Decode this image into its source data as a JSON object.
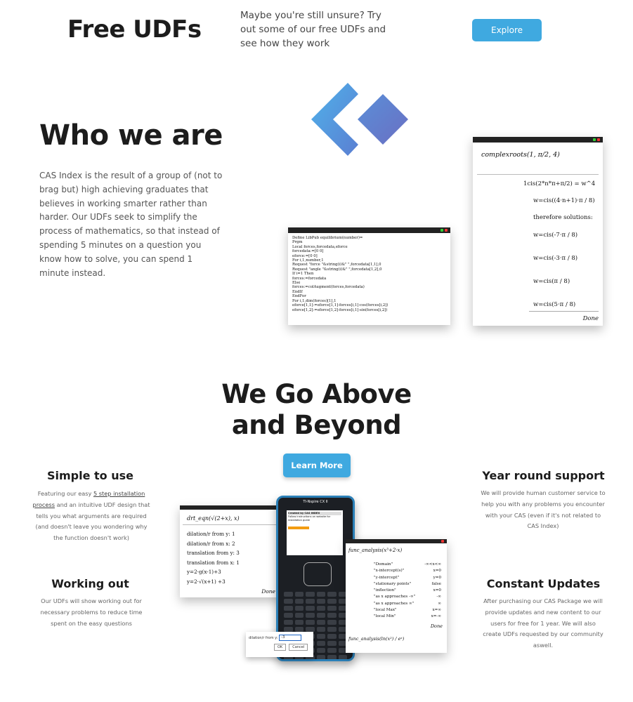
{
  "free_udfs": {
    "title": "Free UDFs",
    "text": "Maybe you're still unsure? Try out some of our free UDFs and see how they work",
    "button": "Explore"
  },
  "who": {
    "title": "Who we are",
    "text": "CAS Index is the result of a group of (not to brag but) high achieving graduates that believes in working smarter rather than harder. Our UDFs seek to simplify the process of mathematics, so that instead of spending 5 minutes on a question you know how to solve, you can spend 1 minute instead."
  },
  "code_card": {
    "lines": [
      "Define LibPub equilibrium(number)=",
      "Prgm",
      "Local forces,forcedata,eforce",
      "forcedata:=[0  0]",
      "eforce:=[0  0]",
      "For i,1,number,1",
      "  Request \"force \"&string(i)&\" \",forcedata[1,1],0",
      "  Request \"angle \"&string(i)&\" \",forcedata[1,2],0",
      "  If i=1 Then",
      "    forces:=forcedata",
      "  Else",
      "    forces:=colAugment(forces,forcedata)",
      "  EndIf",
      "EndFor",
      "For i,1,dim(forces)[1],1",
      "  eforce[1,1]:=eforce[1,1]-forces[i,1]·cos(forces[i,2])",
      "  eforce[1,2]:=eforce[1,2]-forces[i,1]·sin(forces[i,2])"
    ]
  },
  "complex_card": {
    "head": "complexroots(1, π/2, 4)",
    "first": "1cis(2*n*π+π/2) = w^4",
    "general": "w=cis((4·n+1)·π / 8)",
    "therefore": "therefore solutions:",
    "solutions": [
      "w=cis(-7·π / 8)",
      "w=cis(-3·π / 8)",
      "w=cis(π / 8)",
      "w=cis(5·π / 8)"
    ],
    "done": "Done"
  },
  "above": {
    "title_line1": "We Go Above",
    "title_line2": "and Beyond",
    "button": "Learn More"
  },
  "features": {
    "simple": {
      "title": "Simple to use",
      "text_before": "Featuring our easy ",
      "link": "5 step installation process",
      "text_after": " and an intuitive UDF design that tells you what arguments are required (and doesn't leave you wondering why the function doesn't work)"
    },
    "working": {
      "title": "Working out",
      "text": "Our UDFs will show working out for necessary problems to reduce time spent on the easy questions"
    },
    "support": {
      "title": "Year round support",
      "text": "We will provide human customer service to help you with any problems you encounter with your CAS (even if it's not related to CAS Index)"
    },
    "updates": {
      "title": "Constant Updates",
      "text": "After purchasing our CAS Package we will provide updates and new content to our users for free for 1 year. We will also create UDFs requested by our community aswell."
    }
  },
  "drt_card": {
    "head": "drt_eqn(√(2+x), x)",
    "lines": [
      "dilation/r from y: 1",
      "dilation/r from x: 2",
      "translation from y: 3",
      "translation from x: 1",
      "y=2·g(x-1)+3",
      "y=2·√(x+1) +3"
    ],
    "done": "Done"
  },
  "calc": {
    "brand": "TI-Nspire CX II",
    "screen_title": "Created by CAS INDEX",
    "screen_text": "Follow instructions on website for installation guide"
  },
  "dialog": {
    "label": "dilation/r from y:",
    "value": "-3",
    "ok": "OK",
    "cancel": "Cancel"
  },
  "func_card": {
    "head": "func_analysis(x³+2·x)",
    "rows": [
      [
        "\"Domain\"",
        "-∞<x<∞"
      ],
      [
        "\"x-intercept(s)\"",
        "x=0"
      ],
      [
        "\"y-intercept\"",
        "y=0"
      ],
      [
        "\"stationary points\"",
        "false"
      ],
      [
        "\"inflection\"",
        "x=0"
      ],
      [
        "\"as x approaches -∞\"",
        "-∞"
      ],
      [
        "\"as x approaches ∞\"",
        "∞"
      ],
      [
        "\"local Max\"",
        "x=∞"
      ],
      [
        "\"local Min\"",
        "x=-∞"
      ]
    ],
    "done": "Done",
    "foot": "func_analysis(ln(x²) / eˣ)"
  },
  "colors": {
    "accent": "#3fa9e0",
    "logo_light": "#5aa9e6",
    "logo_dark": "#6a7cc9"
  }
}
